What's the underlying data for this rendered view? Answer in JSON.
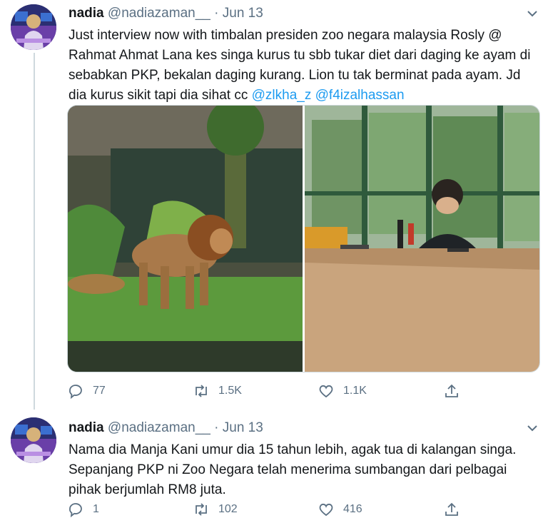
{
  "tweets": [
    {
      "user": {
        "name": "nadia",
        "handle": "@nadiazaman__",
        "separator": "·",
        "date": "Jun 13"
      },
      "text_plain": "Just interview now with timbalan presiden zoo negara malaysia Rosly @ Rahmat Ahmat Lana kes singa kurus tu sbb tukar diet dari daging ke ayam di sebabkan PKP, bekalan daging kurang. Lion tu tak berminat pada ayam. Jd dia kurus sikit tapi dia sihat cc ",
      "mentions": [
        "@zlkha_z",
        "@f4izalhassan"
      ],
      "replies": "77",
      "retweets": "1.5K",
      "likes": "1.1K"
    },
    {
      "user": {
        "name": "nadia",
        "handle": "@nadiazaman__",
        "separator": "·",
        "date": "Jun 13"
      },
      "text_plain": "Nama dia Manja Kani umur dia 15 tahun lebih, agak tua di kalangan singa. Sepanjang PKP ni Zoo Negara telah menerima sumbangan dari pelbagai pihak berjumlah RM8 juta.",
      "replies": "1",
      "retweets": "102",
      "likes": "416"
    }
  ],
  "icons": {
    "reply": "reply-icon",
    "retweet": "retweet-icon",
    "like": "heart-icon",
    "share": "share-icon",
    "more": "chevron-down-icon"
  },
  "colors": {
    "accent": "#1d9bf0",
    "muted": "#5b7083",
    "thread_line": "#cfd9de"
  }
}
